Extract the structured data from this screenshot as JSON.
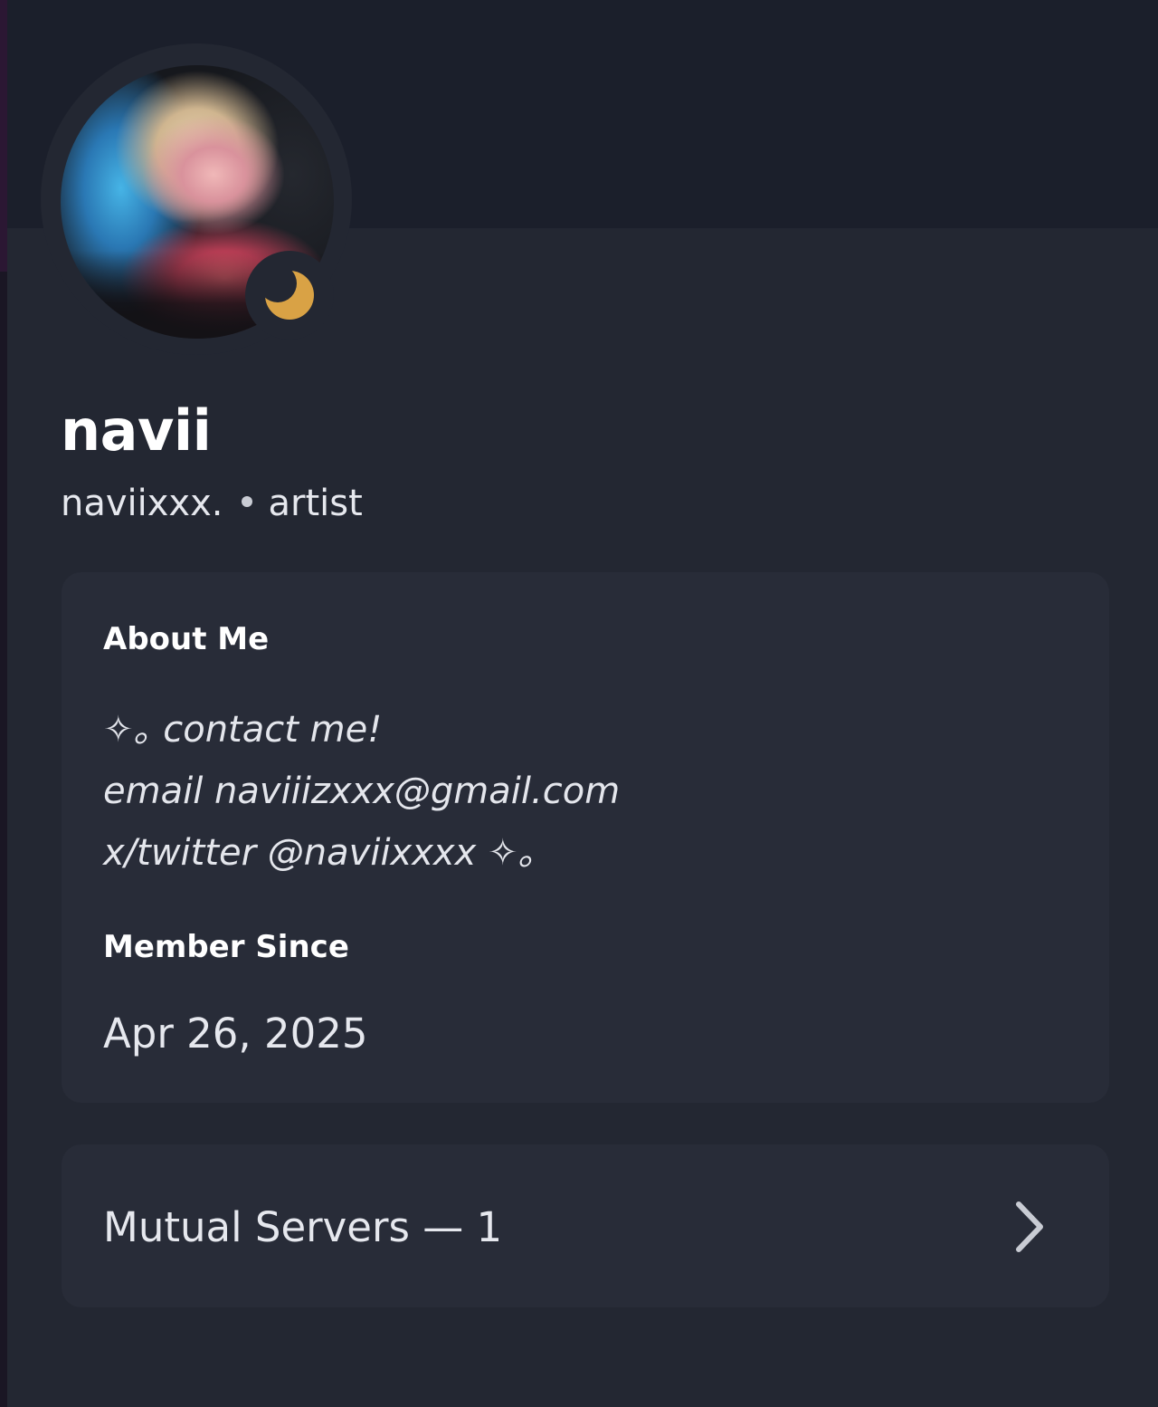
{
  "profile": {
    "display_name": "navii",
    "username": "naviixxx.",
    "pronouns": "artist",
    "status": "idle"
  },
  "about": {
    "heading": "About Me",
    "lines": [
      "✧｡  contact me!",
      "email naviiizxxx@gmail.com",
      "x/twitter @naviixxxx ✧｡"
    ]
  },
  "member_since": {
    "heading": "Member Since",
    "date": "Apr 26, 2025"
  },
  "mutual_servers": {
    "label": "Mutual Servers — 1"
  },
  "icons": {
    "status": "moon-icon",
    "expand": "chevron-right-icon"
  },
  "colors": {
    "background": "#232732",
    "banner": "#1b1f2b",
    "card": "#282c38",
    "idle_status": "#d9a245"
  }
}
